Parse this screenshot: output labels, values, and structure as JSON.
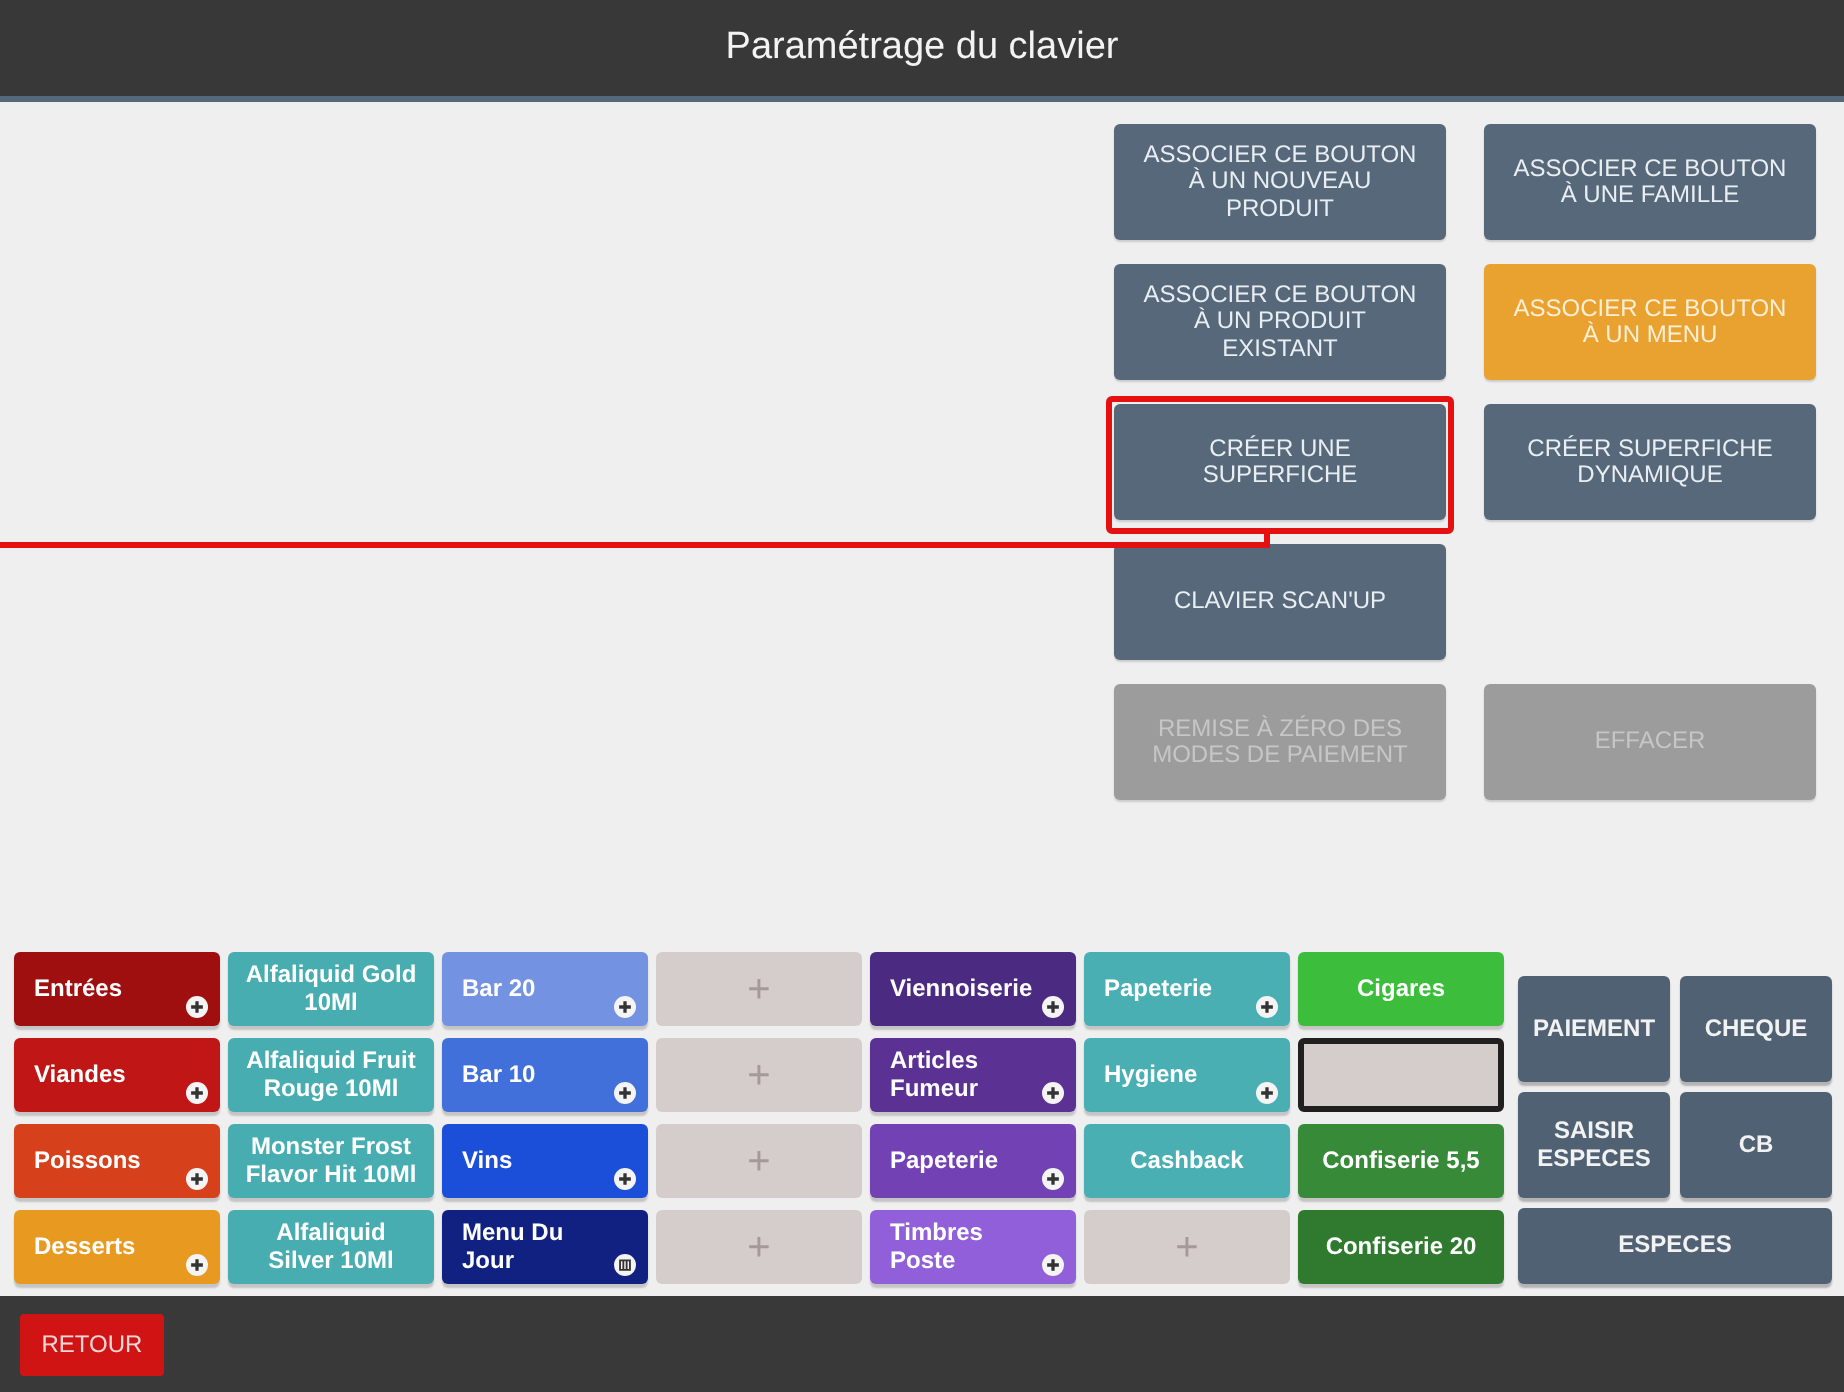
{
  "header": {
    "title": "Paramétrage du clavier"
  },
  "actions": {
    "rows": [
      [
        {
          "label": "ASSOCIER CE BOUTON\nÀ UN NOUVEAU\nPRODUIT",
          "selected": false,
          "disabled": false,
          "highlighted": false
        },
        {
          "label": "ASSOCIER CE BOUTON\nÀ UNE FAMILLE",
          "selected": false,
          "disabled": false,
          "highlighted": false
        }
      ],
      [
        {
          "label": "ASSOCIER CE BOUTON\nÀ UN PRODUIT\nEXISTANT",
          "selected": false,
          "disabled": false,
          "highlighted": false
        },
        {
          "label": "ASSOCIER CE BOUTON\nÀ UN MENU",
          "selected": true,
          "disabled": false,
          "highlighted": false
        }
      ],
      [
        {
          "label": "CRÉER UNE\nSUPERFICHE",
          "selected": false,
          "disabled": false,
          "highlighted": true
        },
        {
          "label": "CRÉER SUPERFICHE\nDYNAMIQUE",
          "selected": false,
          "disabled": false,
          "highlighted": false
        }
      ],
      [
        {
          "label": "CLAVIER SCAN'UP",
          "selected": false,
          "disabled": false,
          "highlighted": false
        }
      ],
      [
        {
          "label": "REMISE À ZÉRO DES\nMODES DE PAIEMENT",
          "selected": false,
          "disabled": true,
          "highlighted": false
        },
        {
          "label": "EFFACER",
          "selected": false,
          "disabled": true,
          "highlighted": false
        }
      ]
    ]
  },
  "keypad": {
    "rows": [
      [
        {
          "label": "Entrées",
          "kind": "family",
          "color": "#a00f0f",
          "selected": false
        },
        {
          "label": "Alfaliquid Gold\n10Ml",
          "kind": "product",
          "color": "#48adb0",
          "selected": false
        },
        {
          "label": "Bar 20",
          "kind": "family",
          "color": "#7392e2",
          "selected": false
        },
        {
          "label": "+",
          "kind": "empty",
          "color": "#d5cdcc",
          "selected": false
        },
        {
          "label": "Viennoiserie",
          "kind": "family",
          "color": "#4b2a82",
          "selected": false
        },
        {
          "label": "Papeterie",
          "kind": "family",
          "color": "#4aafb3",
          "selected": false
        },
        {
          "label": "Cigares",
          "kind": "product",
          "color": "#3cbd3c",
          "selected": false
        }
      ],
      [
        {
          "label": "Viandes",
          "kind": "family",
          "color": "#c01616",
          "selected": false
        },
        {
          "label": "Alfaliquid Fruit\nRouge 10Ml",
          "kind": "product",
          "color": "#48adb0",
          "selected": false
        },
        {
          "label": "Bar 10",
          "kind": "family",
          "color": "#4270da",
          "selected": false
        },
        {
          "label": "+",
          "kind": "empty",
          "color": "#d5cdcc",
          "selected": false
        },
        {
          "label": "Articles\nFumeur",
          "kind": "family",
          "color": "#5b3193",
          "selected": false
        },
        {
          "label": "Hygiene",
          "kind": "family",
          "color": "#4aafb3",
          "selected": false
        },
        {
          "kind": "empty",
          "color": "#d5cdcc",
          "selected": true
        }
      ],
      [
        {
          "label": "Poissons",
          "kind": "family",
          "color": "#d6401a",
          "selected": false
        },
        {
          "label": "Monster Frost\nFlavor Hit 10Ml",
          "kind": "product",
          "color": "#48adb0",
          "selected": false
        },
        {
          "label": "Vins",
          "kind": "family",
          "color": "#1c4fd9",
          "selected": false
        },
        {
          "label": "+",
          "kind": "empty",
          "color": "#d5cdcc",
          "selected": false
        },
        {
          "label": "Papeterie",
          "kind": "family",
          "color": "#7241b3",
          "selected": false
        },
        {
          "label": "Cashback",
          "kind": "product",
          "color": "#4aafb3",
          "selected": false
        },
        {
          "label": "Confiserie 5,5",
          "kind": "product",
          "color": "#378a37",
          "selected": false
        }
      ],
      [
        {
          "label": "Desserts",
          "kind": "family",
          "color": "#e8991f",
          "selected": false
        },
        {
          "label": "Alfaliquid\nSilver 10Ml",
          "kind": "product",
          "color": "#48adb0",
          "selected": false
        },
        {
          "label": "Menu Du\nJour",
          "kind": "menu",
          "color": "#112181",
          "selected": false
        },
        {
          "label": "+",
          "kind": "empty",
          "color": "#d5cdcc",
          "selected": false
        },
        {
          "label": "Timbres\nPoste",
          "kind": "family",
          "color": "#905fd9",
          "selected": false
        },
        {
          "label": "+",
          "kind": "empty",
          "color": "#d5cdcc",
          "selected": false
        },
        {
          "label": "Confiserie 20",
          "kind": "product",
          "color": "#2f7a2f",
          "selected": false
        }
      ]
    ]
  },
  "payment": {
    "buttons": [
      {
        "label": "PAIEMENT",
        "kind": "half"
      },
      {
        "label": "CHEQUE",
        "kind": "half"
      },
      {
        "label": "SAISIR\nESPECES",
        "kind": "half"
      },
      {
        "label": "CB",
        "kind": "half"
      },
      {
        "label": "ESPECES",
        "kind": "full"
      }
    ]
  },
  "footer": {
    "back_button": "RETOUR"
  }
}
